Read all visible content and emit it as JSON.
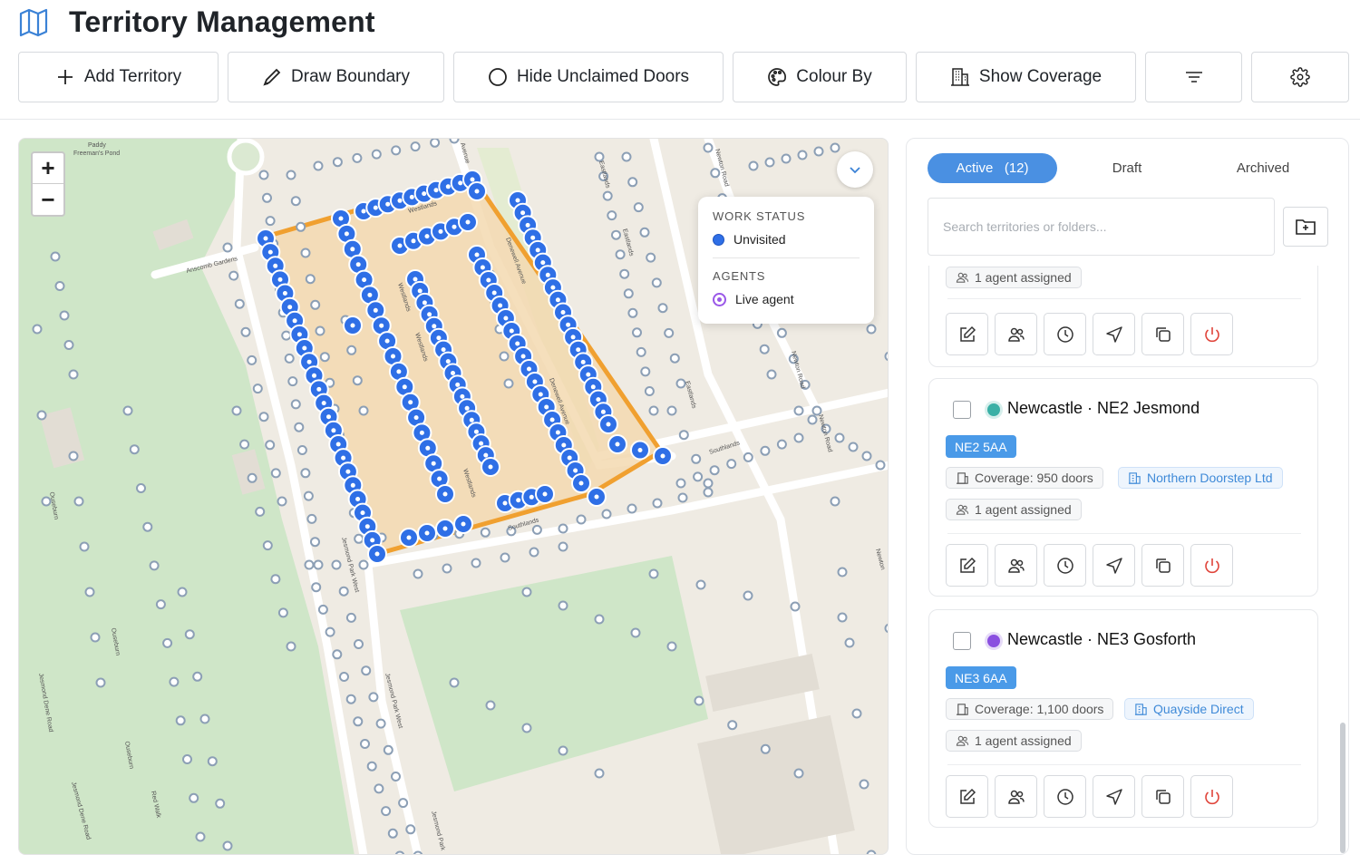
{
  "app": {
    "title": "Territory Management"
  },
  "toolbar": {
    "add_territory": "Add Territory",
    "draw_boundary": "Draw Boundary",
    "hide_unclaimed": "Hide Unclaimed Doors",
    "colour_by": "Colour By",
    "show_coverage": "Show Coverage"
  },
  "map": {
    "legend": {
      "work_status_heading": "WORK STATUS",
      "unvisited": "Unvisited",
      "agents_heading": "AGENTS",
      "live_agent": "Live agent"
    },
    "labels": {
      "paddy": "Paddy",
      "freemans_pond": "Freeman's Pond",
      "anscomb_gardens": "Anscomb Gardens",
      "westlands1": "Westlands",
      "westlands2": "Westlands",
      "westlands3": "Westlands",
      "westlands4": "Westlands",
      "denewell_avenue1": "Denewell Avenue",
      "denewell_avenue2": "Denewell Avenue",
      "eastlands1": "Eastlands",
      "eastlands2": "Eastlands",
      "eastlands3": "Eastlands",
      "newton_road1": "Newton Road",
      "newton_road2": "Newton Road",
      "newton_road3": "Newton Road",
      "newton_road4": "Newton",
      "southlands1": "Southlands",
      "southlands2": "Southlands",
      "jesmond_park_west1": "Jesmond Park West",
      "jesmond_park_west2": "Jesmond Park West",
      "jesmond_park_west3": "Jesmond Park",
      "jesmond_dene_road1": "Jesmond Dene Road",
      "jesmond_dene_road2": "Jesmond Dene Road",
      "ouseburn1": "Ouseburn",
      "ouseburn2": "Ouseburn",
      "ouseburn3": "Ouseburn",
      "red_walk": "Red Walk",
      "avenue": "Avenue"
    },
    "colors": {
      "boundary": "#f0a030",
      "fill": "#f3d9b0",
      "marker": "#2f6fe6",
      "park": "#cfe6c8"
    }
  },
  "panel": {
    "tabs": [
      {
        "label": "Active",
        "count": "(12)"
      },
      {
        "label": "Draft"
      },
      {
        "label": "Archived"
      }
    ],
    "search_placeholder": "Search territories or folders...",
    "cards": [
      {
        "agents": "1 agent assigned"
      },
      {
        "name": "Newcastle · NE2 Jesmond",
        "status_color": "#3ab0a6",
        "postcode": "NE2 5AA",
        "coverage": "Coverage: 950 doors",
        "agency": "Northern Doorstep Ltd",
        "agents": "1 agent assigned"
      },
      {
        "name": "Newcastle · NE3 Gosforth",
        "status_color": "#8a4fe0",
        "postcode": "NE3 6AA",
        "coverage": "Coverage: 1,100 doors",
        "agency": "Quayside Direct",
        "agents": "1 agent assigned"
      }
    ]
  }
}
